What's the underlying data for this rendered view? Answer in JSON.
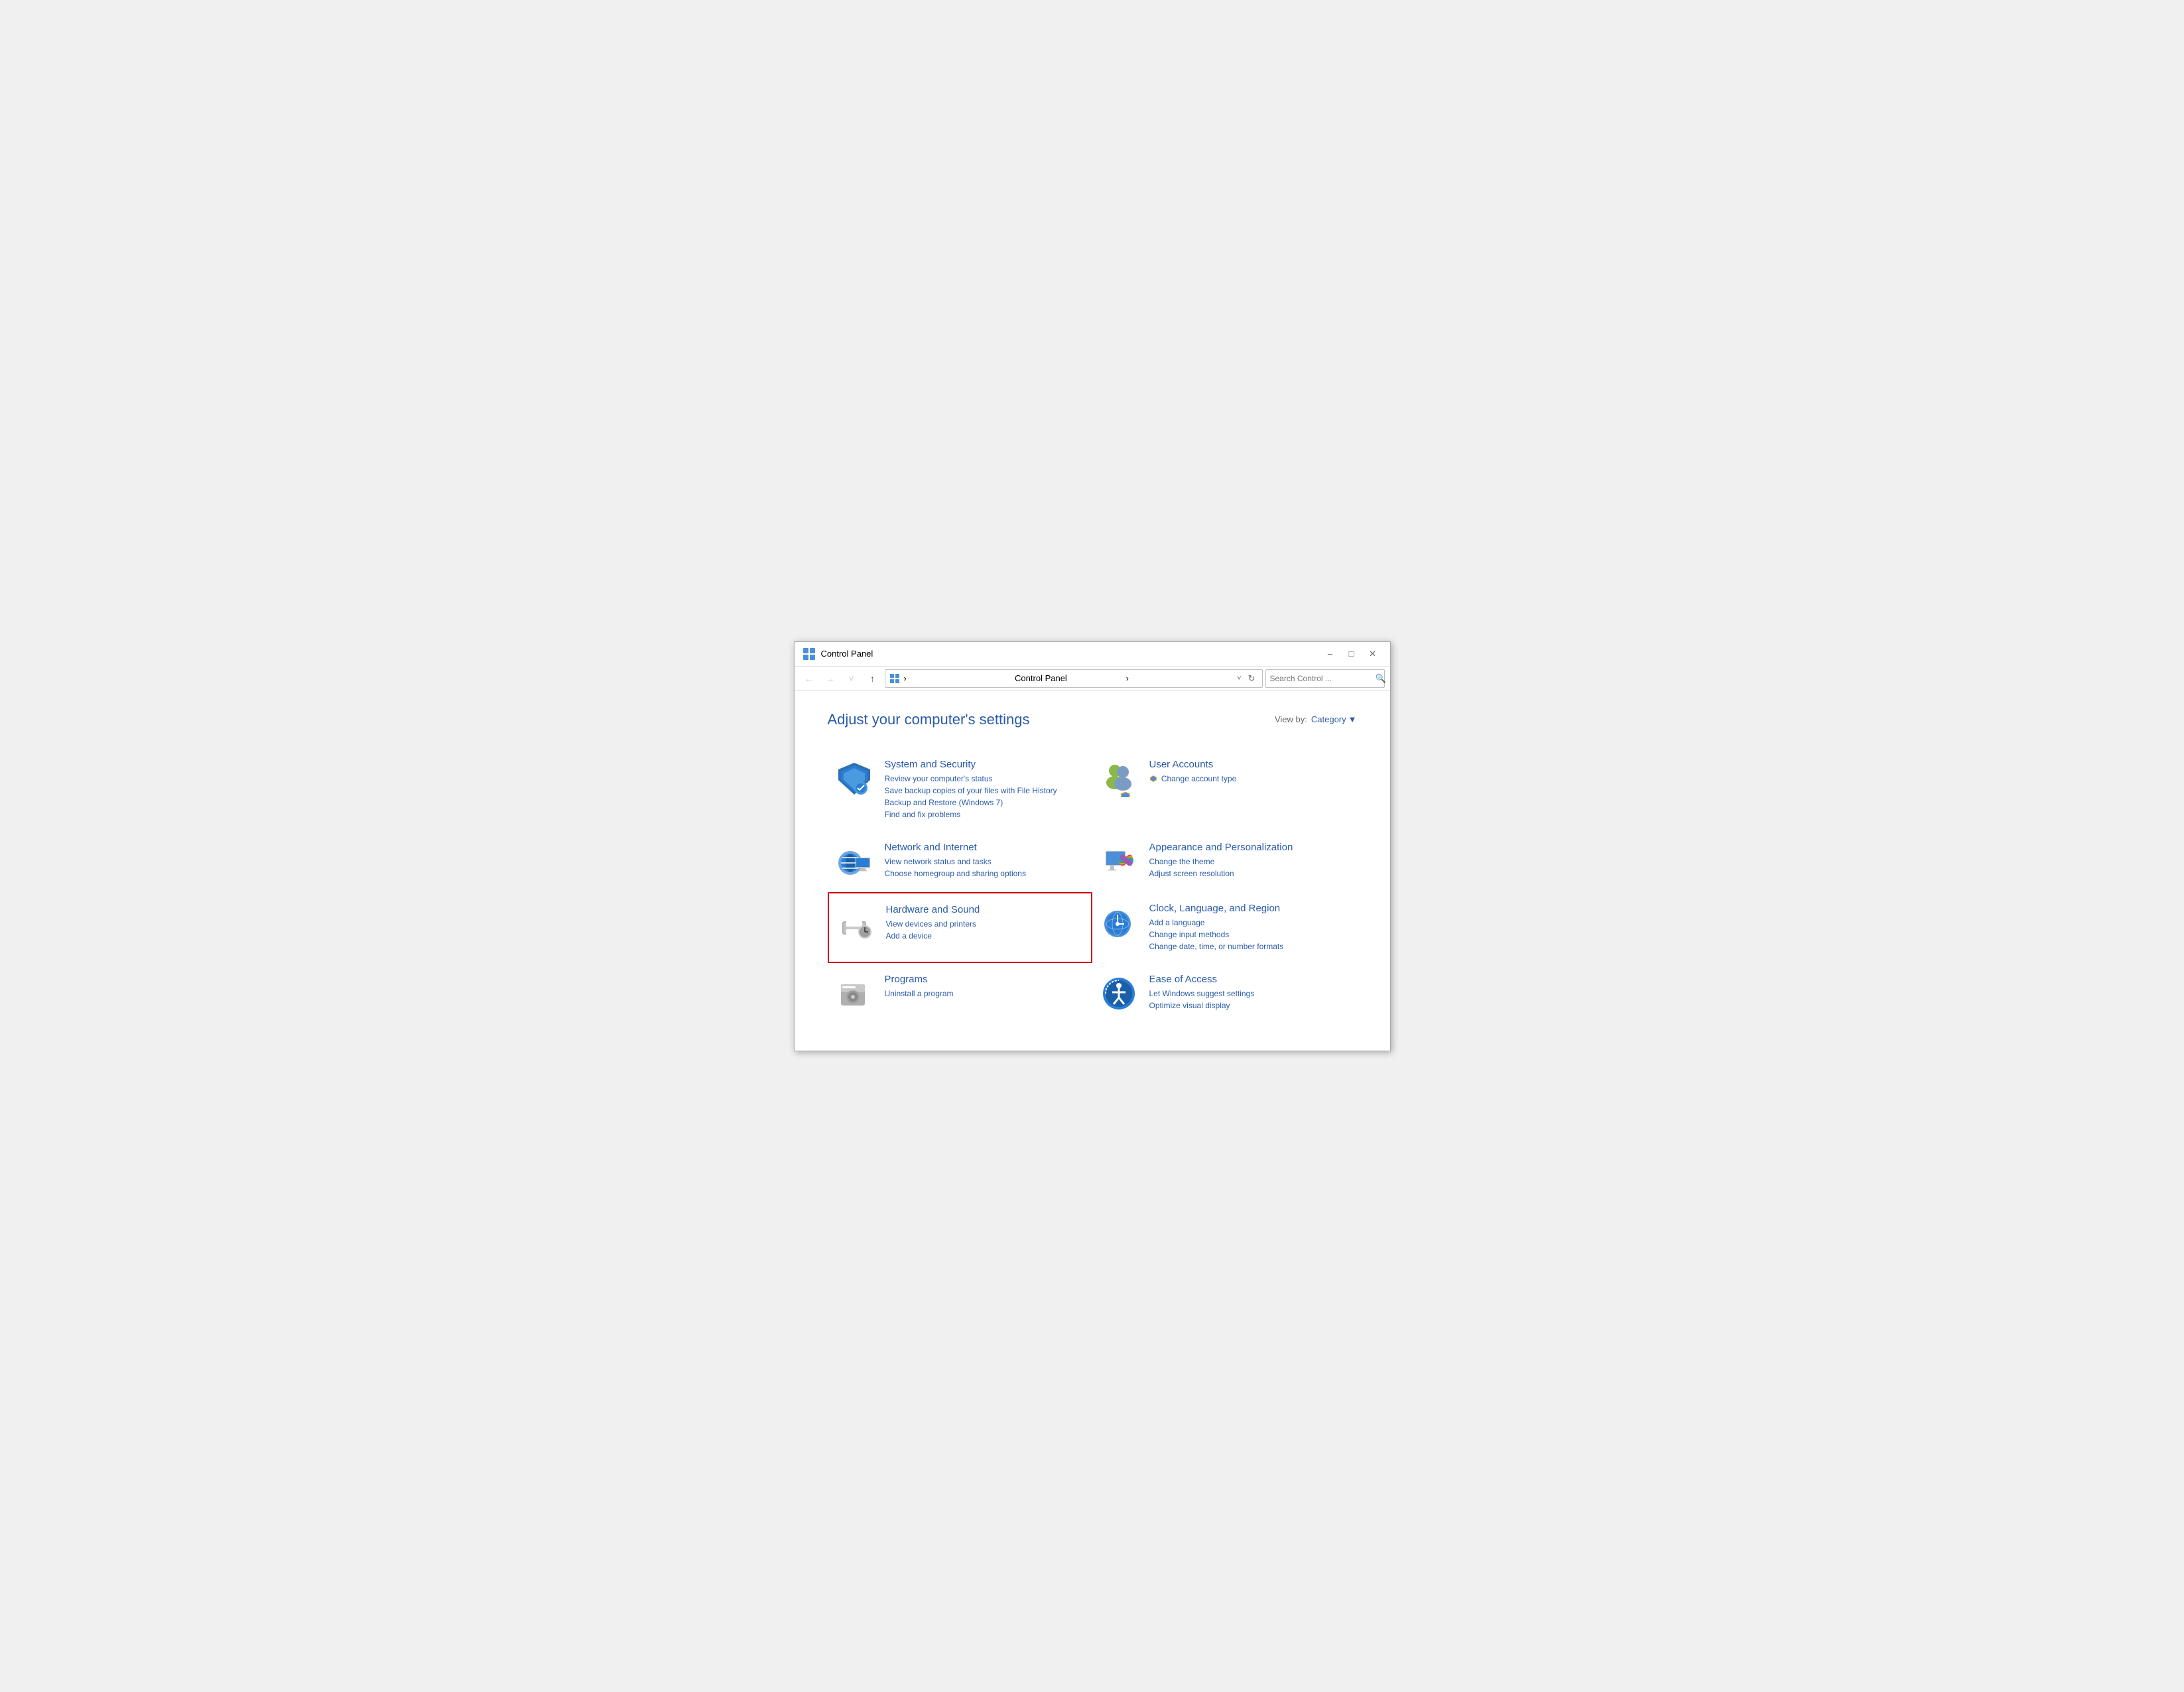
{
  "window": {
    "title": "Control Panel",
    "minimize_label": "–",
    "maximize_label": "□",
    "close_label": "✕"
  },
  "toolbar": {
    "back_label": "←",
    "forward_label": "→",
    "chevron_label": "˅",
    "up_label": "↑",
    "address": "Control Panel",
    "address_chevron": "˅",
    "refresh_label": "↻",
    "search_placeholder": "Search Control ...",
    "search_icon": "🔍"
  },
  "page": {
    "title": "Adjust your computer's settings",
    "view_by_label": "View by:",
    "view_by_value": "Category",
    "view_by_arrow": "▼"
  },
  "categories": [
    {
      "id": "system-security",
      "title": "System and Security",
      "links": [
        "Review your computer's status",
        "Save backup copies of your files with File History",
        "Backup and Restore (Windows 7)",
        "Find and fix problems"
      ],
      "highlighted": false
    },
    {
      "id": "user-accounts",
      "title": "User Accounts",
      "links": [
        "Change account type"
      ],
      "highlighted": false
    },
    {
      "id": "network-internet",
      "title": "Network and Internet",
      "links": [
        "View network status and tasks",
        "Choose homegroup and sharing options"
      ],
      "highlighted": false
    },
    {
      "id": "appearance-personalization",
      "title": "Appearance and Personalization",
      "links": [
        "Change the theme",
        "Adjust screen resolution"
      ],
      "highlighted": false
    },
    {
      "id": "hardware-sound",
      "title": "Hardware and Sound",
      "links": [
        "View devices and printers",
        "Add a device"
      ],
      "highlighted": true
    },
    {
      "id": "clock-language-region",
      "title": "Clock, Language, and Region",
      "links": [
        "Add a language",
        "Change input methods",
        "Change date, time, or number formats"
      ],
      "highlighted": false
    },
    {
      "id": "programs",
      "title": "Programs",
      "links": [
        "Uninstall a program"
      ],
      "highlighted": false
    },
    {
      "id": "ease-of-access",
      "title": "Ease of Access",
      "links": [
        "Let Windows suggest settings",
        "Optimize visual display"
      ],
      "highlighted": false
    }
  ]
}
